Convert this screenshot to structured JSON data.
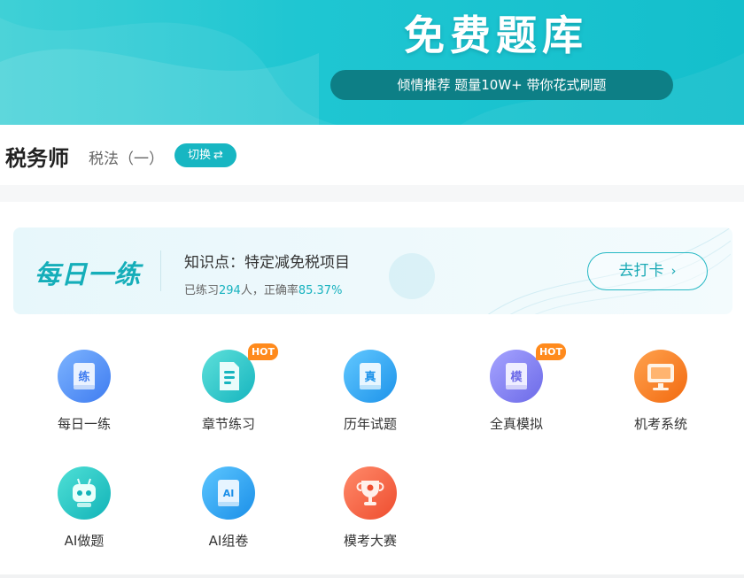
{
  "banner": {
    "title": "免费题库",
    "slogan": "倾情推荐 题量10W+ 带你花式刷题",
    "colors": {
      "bg_start": "#3fd0d6",
      "bg_end": "#14bfcc",
      "pill": "#0d7f86"
    }
  },
  "subject": {
    "title": "税务师",
    "subtitle": "税法（一）",
    "switch_label": "切换",
    "switch_icon": "swap-arrows-icon"
  },
  "daily": {
    "logo_text": "每日一练",
    "topic": "知识点：特定减免税项目",
    "stats_prefix": "已练习",
    "practice_count": "294",
    "stats_mid": "人，正确率",
    "accuracy": "85.37%",
    "checkin_label": "去打卡",
    "checkin_icon": "chevron-right-icon",
    "accent": "#17b2bf"
  },
  "features": [
    {
      "label": "每日一练",
      "icon": "practice-book-icon",
      "glyph": "练",
      "hot": false
    },
    {
      "label": "章节练习",
      "icon": "chapter-document-icon",
      "glyph": "",
      "hot": true,
      "hot_label": "HOT"
    },
    {
      "label": "历年试题",
      "icon": "past-exam-book-icon",
      "glyph": "真",
      "hot": false
    },
    {
      "label": "全真模拟",
      "icon": "mock-exam-book-icon",
      "glyph": "模",
      "hot": true,
      "hot_label": "HOT"
    },
    {
      "label": "机考系统",
      "icon": "computer-monitor-icon",
      "glyph": "",
      "hot": false
    },
    {
      "label": "AI做题",
      "icon": "robot-icon",
      "glyph": "",
      "hot": false
    },
    {
      "label": "AI组卷",
      "icon": "ai-paper-icon",
      "glyph": "AI",
      "hot": false
    },
    {
      "label": "模考大赛",
      "icon": "trophy-icon",
      "glyph": "",
      "hot": false
    }
  ]
}
